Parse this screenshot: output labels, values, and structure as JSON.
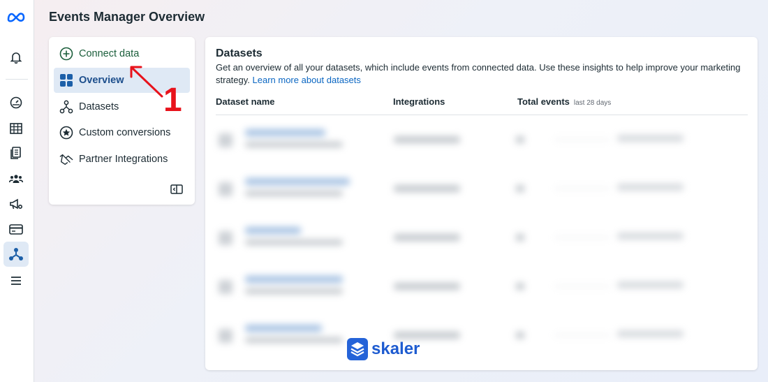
{
  "app": {
    "page_title": "Events Manager Overview"
  },
  "rail": {
    "icons": [
      "meta-logo-icon",
      "bell-icon",
      "gauge-icon",
      "table-icon",
      "document-icon",
      "people-icon",
      "megaphone-gear-icon",
      "card-icon",
      "events-graph-icon",
      "menu-icon"
    ],
    "active": "events-graph-icon"
  },
  "nav": {
    "connect_label": "Connect data",
    "items": [
      {
        "label": "Overview",
        "icon": "overview-grid-icon",
        "active": true
      },
      {
        "label": "Datasets",
        "icon": "datasets-icon",
        "active": false
      },
      {
        "label": "Custom conversions",
        "icon": "star-circle-icon",
        "active": false
      },
      {
        "label": "Partner Integrations",
        "icon": "handshake-icon",
        "active": false
      }
    ]
  },
  "annotation": {
    "number": "1",
    "color": "#e8121b"
  },
  "datasets": {
    "title": "Datasets",
    "description": "Get an overview of all your datasets, which include events from connected data. Use these insights to help improve your marketing strategy.",
    "link": "Learn more about datasets",
    "columns": {
      "name": "Dataset name",
      "integrations": "Integrations",
      "events": "Total events",
      "events_sub": "last 28 days"
    },
    "rows_blurred": 5
  },
  "watermark": {
    "text": "skaler"
  },
  "colors": {
    "accent": "#0a66c2",
    "connect_green": "#1b5e3b",
    "active_bg": "#dfe9f5"
  }
}
